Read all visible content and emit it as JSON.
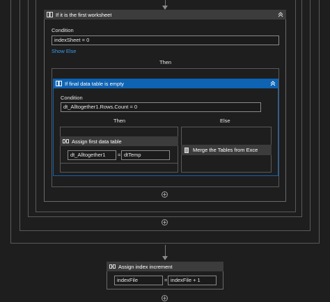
{
  "outer_if": {
    "title": "If it is the first worksheet",
    "condition_label": "Condition",
    "condition_value": "indexSheet = 0",
    "show_else": "Show Else",
    "then_label": "Then"
  },
  "inner_if": {
    "title": "If final data table is empty",
    "condition_label": "Condition",
    "condition_value": "dt_Alltogether1.Rows.Count = 0",
    "then_label": "Then",
    "else_label": "Else"
  },
  "assign_first": {
    "title": "Assign first data table",
    "to_value": "dt_Alltogether1",
    "eq": "=",
    "from_value": "dtTemp"
  },
  "merge": {
    "title": "Merge the Tables from Exce"
  },
  "assign_increment": {
    "title": "Assign index increment",
    "to_value": "indexFile",
    "eq": "=",
    "from_value": "indexFile + 1"
  },
  "icons": {
    "if_activity": "if-activity-icon",
    "assign_activity": "assign-activity-icon",
    "merge_activity": "merge-activity-icon",
    "collapse": "chevron-double-up-icon",
    "add": "plus-circle-icon"
  },
  "colors": {
    "background": "#1e1e1e",
    "header_gray": "#3c3c3c",
    "selected_blue": "#0e63b3",
    "link_blue": "#3d9be9"
  }
}
